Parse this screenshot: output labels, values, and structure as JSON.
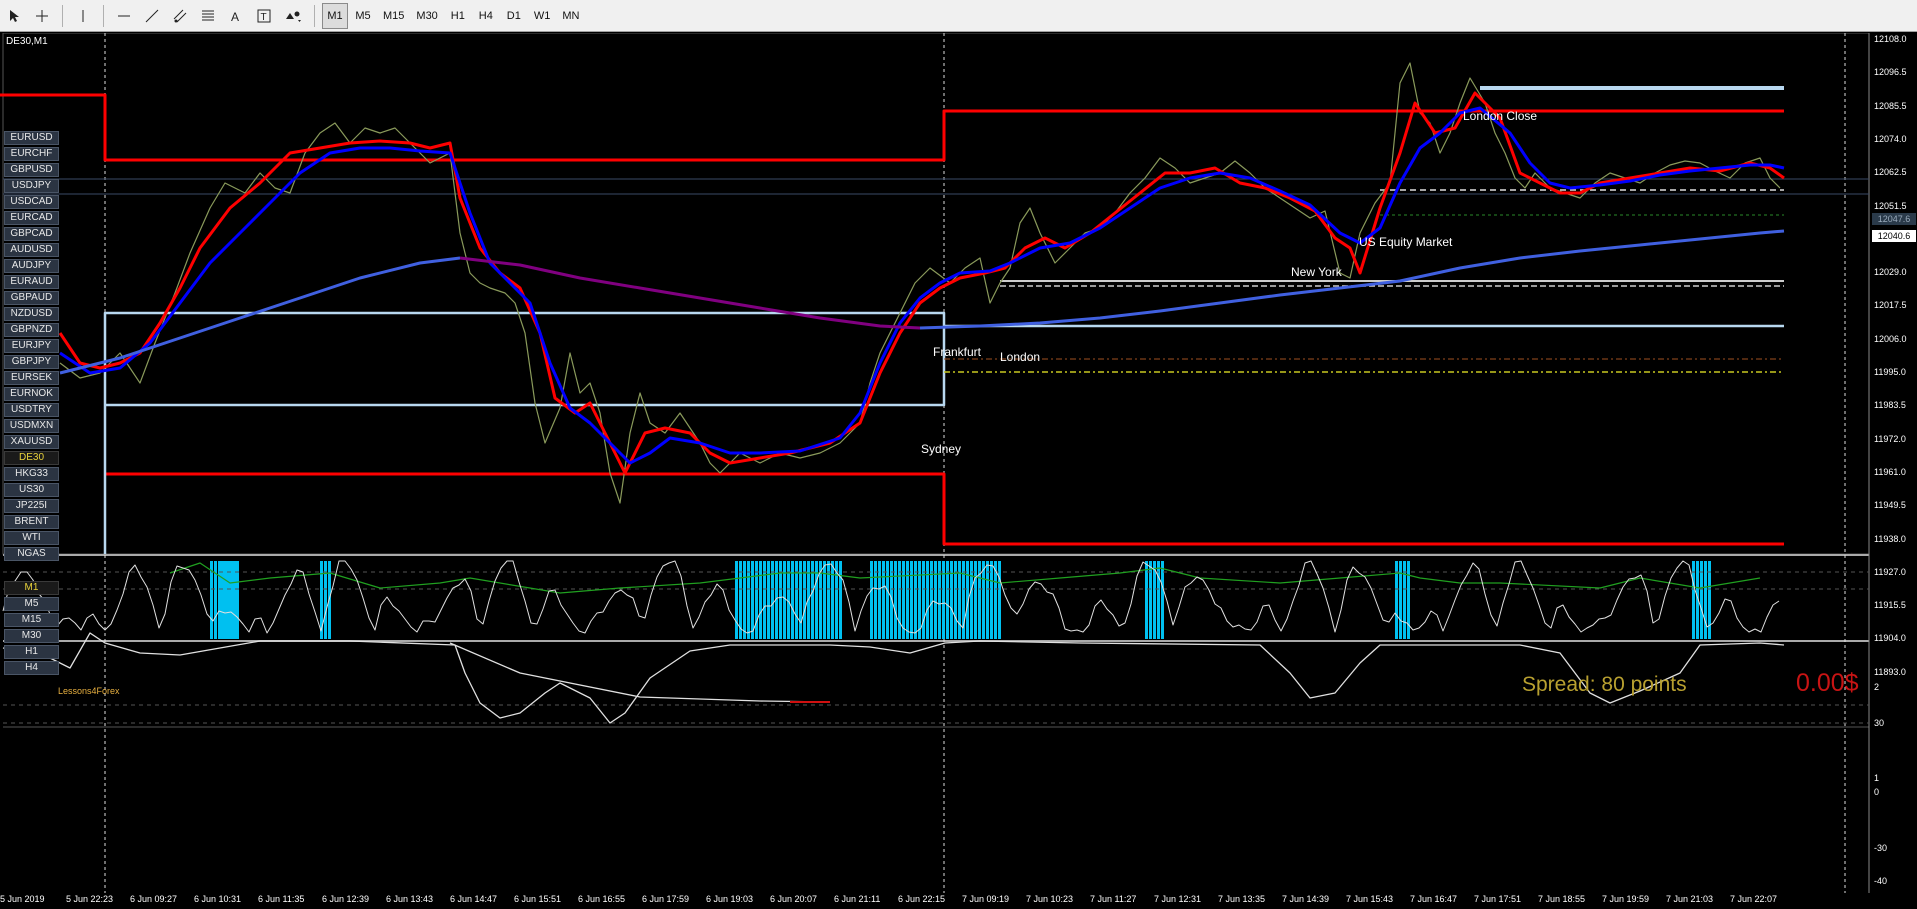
{
  "toolbar": {
    "tools": [
      {
        "name": "cursor-icon",
        "glyph": "cursor"
      },
      {
        "name": "crosshair-icon",
        "glyph": "crosshair"
      },
      {
        "name": "vertical-line-icon",
        "glyph": "vline"
      },
      {
        "name": "horizontal-line-icon",
        "glyph": "hline"
      },
      {
        "name": "trendline-icon",
        "glyph": "trend"
      },
      {
        "name": "equidistant-channel-icon",
        "glyph": "channel"
      },
      {
        "name": "fibonacci-icon",
        "glyph": "fibo"
      },
      {
        "name": "text-icon",
        "glyph": "A"
      },
      {
        "name": "text-label-icon",
        "glyph": "T"
      },
      {
        "name": "shapes-icon",
        "glyph": "shapes"
      }
    ],
    "timeframes": [
      "M1",
      "M5",
      "M15",
      "M30",
      "H1",
      "H4",
      "D1",
      "W1",
      "MN"
    ],
    "active_timeframe": "M1"
  },
  "chart": {
    "title": "DE30,M1",
    "symbols": [
      "EURUSD",
      "EURCHF",
      "GBPUSD",
      "USDJPY",
      "USDCAD",
      "EURCAD",
      "GBPCAD",
      "AUDUSD",
      "AUDJPY",
      "EURAUD",
      "GBPAUD",
      "NZDUSD",
      "GBPNZD",
      "EURJPY",
      "GBPJPY",
      "EURSEK",
      "EURNOK",
      "USDTRY",
      "USDMXN",
      "XAUUSD",
      "DE30",
      "HKG33",
      "US30",
      "JP225I",
      "BRENT",
      "WTI",
      "NGAS"
    ],
    "active_symbol": "DE30",
    "timeframe_buttons": [
      "M1",
      "M5",
      "M15",
      "M30",
      "H1",
      "H4"
    ],
    "active_timeframe_button": "M1",
    "session_labels": {
      "london_close": "London Close",
      "us_equity": "US Equity Market",
      "new_york": "New York",
      "frankfurt": "Frankfurt",
      "london": "London",
      "sydney": "Sydney"
    },
    "spread_text": "Spread: 80 points",
    "profit_text": "0.00$",
    "brand_text": "Lessons4Forex",
    "price_axis": [
      "12108.0",
      "12096.5",
      "12085.5",
      "12074.0",
      "12062.5",
      "12051.5",
      "12040.6",
      "12029.0",
      "12017.5",
      "12006.0",
      "11995.0",
      "11983.5",
      "11972.0",
      "11961.0",
      "11949.5",
      "11938.0",
      "11927.0",
      "11915.5",
      "11904.0",
      "11893.0"
    ],
    "current_price_top": "12047.6",
    "current_price_bottom": "12040.6",
    "indicator1_axis": [
      "2",
      "30",
      "1"
    ],
    "indicator2_axis": [
      "0",
      "-30",
      "-40"
    ],
    "time_axis": [
      "5 Jun 2019",
      "5 Jun 22:23",
      "6 Jun 09:27",
      "6 Jun 10:31",
      "6 Jun 11:35",
      "6 Jun 12:39",
      "6 Jun 13:43",
      "6 Jun 14:47",
      "6 Jun 15:51",
      "6 Jun 16:55",
      "6 Jun 17:59",
      "6 Jun 19:03",
      "6 Jun 20:07",
      "6 Jun 21:11",
      "6 Jun 22:15",
      "7 Jun 09:19",
      "7 Jun 10:23",
      "7 Jun 11:27",
      "7 Jun 12:31",
      "7 Jun 13:35",
      "7 Jun 14:39",
      "7 Jun 15:43",
      "7 Jun 16:47",
      "7 Jun 17:51",
      "7 Jun 18:55",
      "7 Jun 19:59",
      "7 Jun 21:03",
      "7 Jun 22:07"
    ],
    "colors": {
      "price": "#8a9a5b",
      "fast_ma": "#ff0000",
      "slow_ma": "#0000ff",
      "long_ma": "#4060e0",
      "long_ma_alt": "#800080",
      "box_red": "#ff0000",
      "box_blue": "#b8d8f0",
      "histogram": "#00c0f0",
      "spread": "#b8a030",
      "profit": "#c81414"
    }
  }
}
